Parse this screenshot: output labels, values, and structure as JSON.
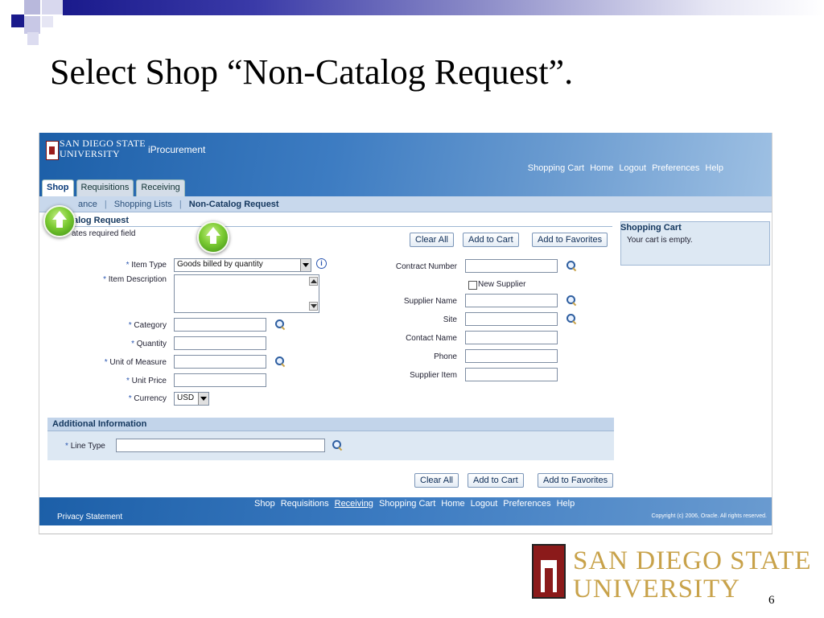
{
  "slide": {
    "title": "Select Shop “Non-Catalog Request”.",
    "page_number": "6",
    "footer_logo_line1": "SAN DIEGO STATE",
    "footer_logo_line2": "UNIVERSITY"
  },
  "app": {
    "university_line1": "SAN DIEGO STATE",
    "university_line2": "UNIVERSITY",
    "name": "iProcurement",
    "global_links": [
      "Shopping Cart",
      "Home",
      "Logout",
      "Preferences",
      "Help"
    ],
    "tabs": [
      "Shop",
      "Requisitions",
      "Receiving"
    ],
    "subnav": {
      "item1": "ance",
      "item2": "Shopping Lists",
      "item3": "Non-Catalog Request"
    }
  },
  "form": {
    "header": "alog Request",
    "required_note": "ates required field",
    "buttons": {
      "clear_all": "Clear All",
      "add_to_cart": "Add to Cart",
      "add_to_favorites": "Add to Favorites"
    },
    "required_marker": "*",
    "labels": {
      "item_type": "Item Type",
      "item_description": "Item Description",
      "category": "Category",
      "quantity": "Quantity",
      "unit_of_measure": "Unit of Measure",
      "unit_price": "Unit Price",
      "currency": "Currency",
      "contract_number": "Contract Number",
      "new_supplier": "New Supplier",
      "supplier_name": "Supplier Name",
      "site": "Site",
      "contact_name": "Contact Name",
      "phone": "Phone",
      "supplier_item": "Supplier Item",
      "line_type": "Line Type"
    },
    "values": {
      "item_type": "Goods billed by quantity",
      "currency": "USD"
    },
    "additional_info_title": "Additional Information"
  },
  "cart": {
    "title": "Shopping Cart",
    "empty_text": "Your cart is empty."
  },
  "footer": {
    "links": [
      "Shop",
      "Requisitions",
      "Receiving",
      "Shopping Cart",
      "Home",
      "Logout",
      "Preferences",
      "Help"
    ],
    "privacy": "Privacy Statement",
    "copyright": "Copyright (c) 2006, Oracle. All rights reserved."
  },
  "colors": {
    "header_blue": "#3d7cc2",
    "panel_blue": "#dde8f3",
    "sdsu_gold": "#c8a24a",
    "sdsu_red": "#8b1a1a"
  },
  "icons": [
    "search-icon",
    "info-icon",
    "up-arrow-icon"
  ]
}
